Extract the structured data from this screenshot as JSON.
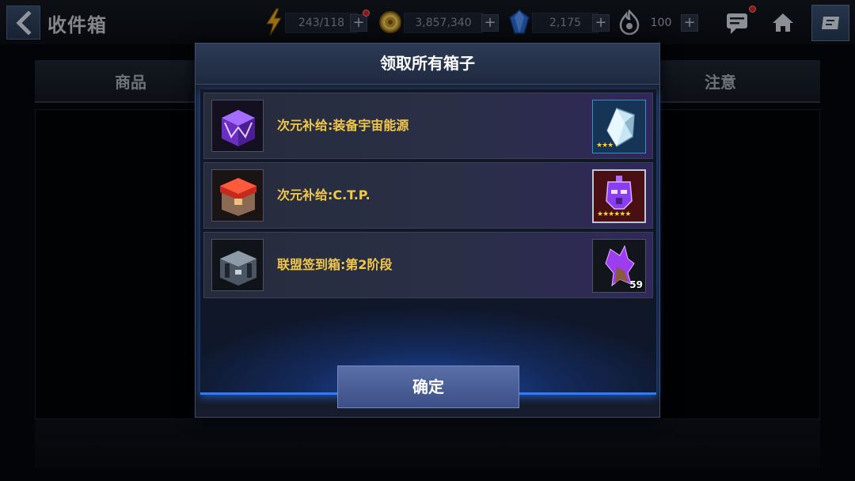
{
  "header": {
    "title": "收件箱",
    "energy": "243/118",
    "gold": "3,857,340",
    "crystals": "2,175",
    "stamina": "100"
  },
  "background_tabs": {
    "left": "商品",
    "right": "注意"
  },
  "modal": {
    "title": "领取所有箱子",
    "confirm_label": "确定",
    "items": [
      {
        "label": "次元补给:装备宇宙能源",
        "reward_stars": "★★★",
        "reward_count": ""
      },
      {
        "label": "次元补给:C.T.P.",
        "reward_stars": "★★★★★★",
        "reward_count": ""
      },
      {
        "label": "联盟签到箱:第2阶段",
        "reward_stars": "",
        "reward_count": "59"
      }
    ]
  },
  "colors": {
    "item_label": "#f1c84a",
    "accent_blue": "#2f7bff",
    "star": "#ffd23a",
    "notification": "#d42424"
  }
}
